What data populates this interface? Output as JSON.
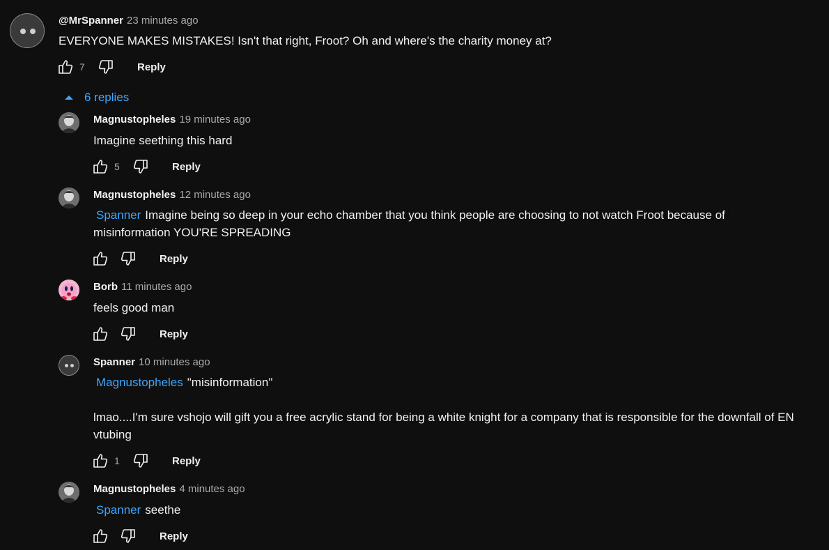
{
  "top_comment": {
    "author": "@MrSpanner",
    "time": "23 minutes ago",
    "text": "EVERYONE MAKES MISTAKES! Isn't that right, Froot? Oh and where's the charity money at?",
    "likes": "7",
    "reply_label": "Reply"
  },
  "replies_toggle": {
    "label": "6 replies",
    "icon": "caret-up-icon"
  },
  "replies": [
    {
      "author": "Magnustopheles",
      "time": "19 minutes ago",
      "mention": "",
      "text": "Imagine seething this hard",
      "likes": "5",
      "reply_label": "Reply"
    },
    {
      "author": "Magnustopheles",
      "time": "12 minutes ago",
      "mention": "Spanner",
      "text": "Imagine being so deep in your echo chamber that you think people are choosing to not watch Froot because of",
      "text2": "misinformation YOU'RE SPREADING",
      "likes": "",
      "reply_label": "Reply"
    },
    {
      "author": "Borb",
      "time": "11 minutes ago",
      "mention": "",
      "text": "feels good man",
      "likes": "",
      "reply_label": "Reply"
    },
    {
      "author": "Spanner",
      "time": "10 minutes ago",
      "mention": "Magnustopheles",
      "text": "\"misinformation\"",
      "text2": "lmao....I'm sure vshojo will gift you a free acrylic stand for being a white knight for a company that is responsible for the downfall of EN",
      "text3": "vtubing",
      "likes": "1",
      "reply_label": "Reply"
    },
    {
      "author": "Magnustopheles",
      "time": "4 minutes ago",
      "mention": "Spanner",
      "text": "seethe",
      "likes": "",
      "reply_label": "Reply"
    }
  ],
  "colors": {
    "background": "#0f0f0f",
    "text": "#f1f1f1",
    "secondary": "#aaaaaa",
    "link": "#3ea6ff"
  }
}
